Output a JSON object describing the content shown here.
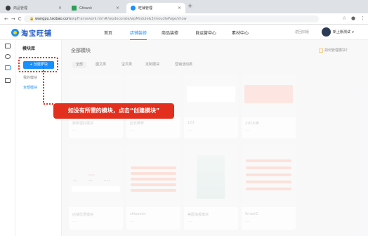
{
  "browser": {
    "tabs": [
      {
        "title": "商品管理",
        "icon_color": "#3b3b3b"
      },
      {
        "title": "Gtbank",
        "icon_color": "#2aa058"
      },
      {
        "title": "旺铺管理",
        "icon_color": "#1890ff"
      }
    ],
    "url_host": "wangpu.taobao.com",
    "url_path": "/wpFramework.htm#/wpdecorate/wpModule&3/moudlePage/show"
  },
  "header": {
    "logo_text": "淘宝旺铺",
    "nav": [
      "首页",
      "店铺装修",
      "商品装修",
      "自运营中心",
      "素材中心"
    ],
    "active_nav": 1,
    "back_old": "返回旧版",
    "account": "新上账测试 ∨"
  },
  "sidebar": {
    "title": "模块库",
    "create_button": "+ 创建模块",
    "links": [
      "我的模块",
      "全部模块"
    ]
  },
  "main": {
    "title": "全部模块",
    "help": "如何管理模块?",
    "filters": [
      "全部",
      "图文类",
      "宝贝类",
      "定制模块",
      "营销活动类"
    ],
    "cards_row1": [
      {
        "name": "新希望好模块"
      },
      {
        "name": "店长推荐"
      },
      {
        "name": "123"
      },
      {
        "name": "小红大卖"
      }
    ],
    "cards_row2": [
      {
        "name": "店铺优惠模块"
      },
      {
        "name": "zhlooolor"
      },
      {
        "name": "美图海报模块"
      },
      {
        "name": "Smart2"
      }
    ],
    "row2_sample_prices": [
      "¥18.8",
      "¥58",
      "¥48"
    ]
  },
  "callout": {
    "text": "如没有所需的模块，点击“创建模块”"
  },
  "colors": {
    "accent": "#1890ff",
    "callout": "#e3301e",
    "pink": "#fbd1c9"
  }
}
